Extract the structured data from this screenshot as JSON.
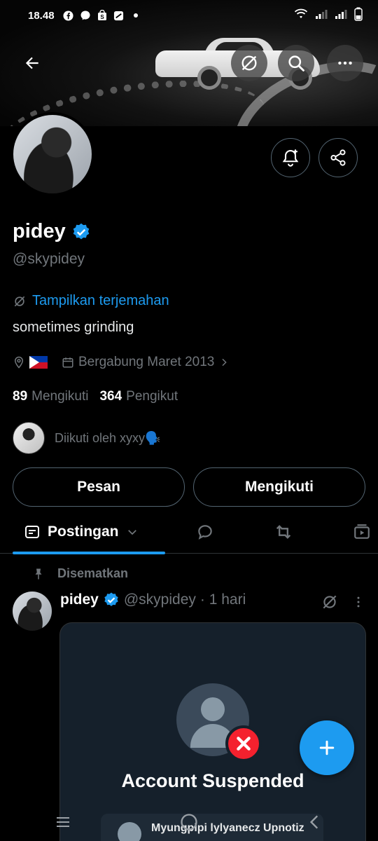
{
  "status_bar": {
    "time": "18.48",
    "notification_icons": [
      "facebook-icon",
      "messenger-icon",
      "shopee-icon",
      "app-icon",
      "dot-icon"
    ],
    "right_icons": [
      "wifi-icon",
      "signal-icon",
      "signal-icon",
      "battery-icon"
    ]
  },
  "header": {
    "back_icon": "arrow-left-icon",
    "translate_icon": "translate-icon",
    "search_icon": "search-icon",
    "more_icon": "more-horizontal-icon"
  },
  "profile": {
    "name": "pidey",
    "handle": "@skypidey",
    "verified": true,
    "translate_label": "Tampilkan terjemahan",
    "bio": "sometimes grinding",
    "location_flag": "philippines-flag",
    "joined": "Bergabung Maret 2013",
    "following_count": "89",
    "following_label": "Mengikuti",
    "followers_count": "364",
    "followers_label": "Pengikut",
    "followed_by": "Diikuti oleh xyxy🗣️"
  },
  "actions": {
    "message_label": "Pesan",
    "following_label": "Mengikuti"
  },
  "tabs": {
    "active_label": "Postingan"
  },
  "post": {
    "pinned_label": "Disematkan",
    "author_name": "pidey",
    "author_handle": "@skypidey",
    "time": "· 1 hari",
    "media": {
      "title": "Account Suspended",
      "inner_text": "Myungpipi lylyanecz Upnotiz"
    }
  },
  "colors": {
    "accent": "#1d9bf0",
    "background": "#000000",
    "muted": "#71767b",
    "suspended_red": "#f4212e"
  }
}
